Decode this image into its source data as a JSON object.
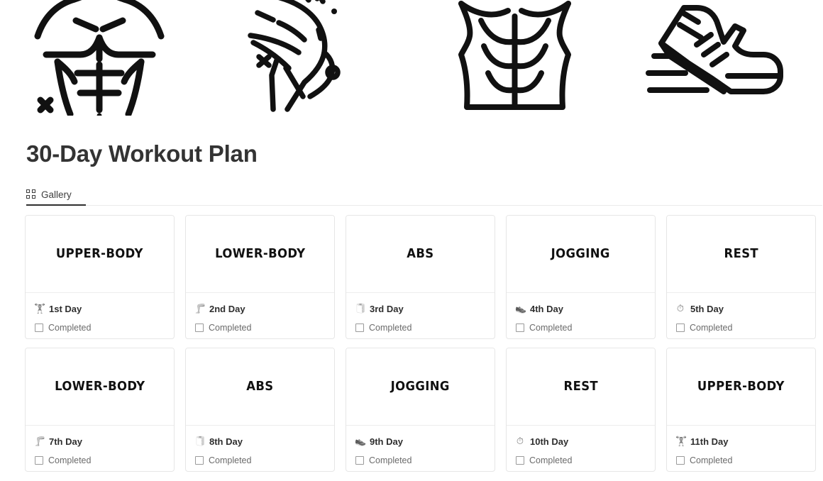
{
  "banner": {
    "images": [
      {
        "name": "upper-body-line-art",
        "alt": "Muscular torso line drawing"
      },
      {
        "name": "leg-line-art",
        "alt": "Bent leg line drawing"
      },
      {
        "name": "abs-line-art",
        "alt": "Abdominal muscles line drawing"
      },
      {
        "name": "running-shoe-line-art",
        "alt": "Running shoe with speed lines"
      }
    ]
  },
  "page_title": "30-Day Workout Plan",
  "tabs": [
    {
      "label": "Gallery",
      "icon": "grid-icon",
      "active": true
    }
  ],
  "labels": {
    "completed": "Completed"
  },
  "colors": {
    "title": "#333333",
    "card_border": "#e6e6e6",
    "divider": "#ededed",
    "tab_active_underline": "#2f2f2f",
    "day_text": "#2e2e2e",
    "completed_text": "#6b6b6b"
  },
  "cards": [
    {
      "workout": "UPPER-BODY",
      "day": "1st Day",
      "emoji": "🏋",
      "emoji_name": "weightlifter-icon",
      "completed": false
    },
    {
      "workout": "LOWER-BODY",
      "day": "2nd Day",
      "emoji": "🦵",
      "emoji_name": "leg-icon",
      "completed": false
    },
    {
      "workout": "ABS",
      "day": "3rd Day",
      "emoji": "🧻",
      "emoji_name": "abs-roller-icon",
      "completed": false
    },
    {
      "workout": "JOGGING",
      "day": "4th Day",
      "emoji": "👟",
      "emoji_name": "running-shoe-icon",
      "completed": false
    },
    {
      "workout": "REST",
      "day": "5th Day",
      "emoji": "⏱",
      "emoji_name": "stopwatch-icon",
      "completed": false
    },
    {
      "workout": "LOWER-BODY",
      "day": "7th Day",
      "emoji": "🦵",
      "emoji_name": "leg-icon",
      "completed": false
    },
    {
      "workout": "ABS",
      "day": "8th Day",
      "emoji": "🧻",
      "emoji_name": "abs-roller-icon",
      "completed": false
    },
    {
      "workout": "JOGGING",
      "day": "9th Day",
      "emoji": "👟",
      "emoji_name": "running-shoe-icon",
      "completed": false
    },
    {
      "workout": "REST",
      "day": "10th Day",
      "emoji": "⏱",
      "emoji_name": "stopwatch-icon",
      "completed": false
    },
    {
      "workout": "UPPER-BODY",
      "day": "11th Day",
      "emoji": "🏋",
      "emoji_name": "weightlifter-icon",
      "completed": false
    }
  ]
}
